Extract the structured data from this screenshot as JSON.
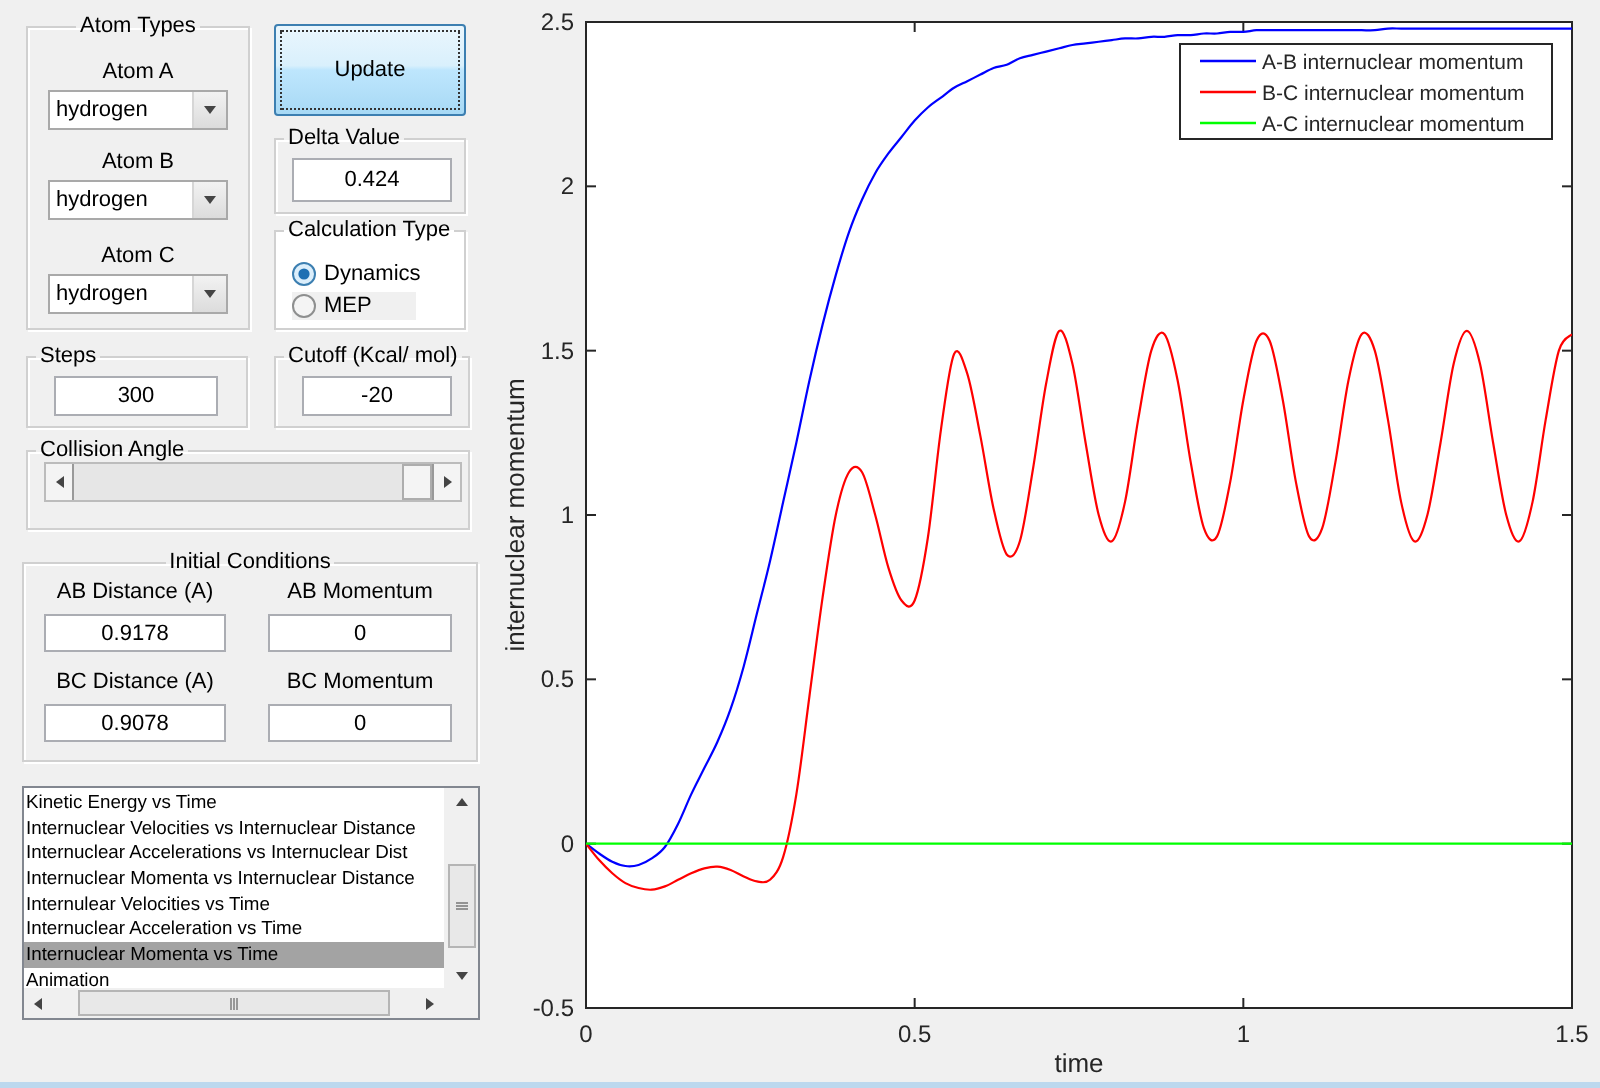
{
  "atom_types": {
    "title": "Atom Types",
    "atoms": [
      {
        "label": "Atom A",
        "value": "hydrogen"
      },
      {
        "label": "Atom B",
        "value": "hydrogen"
      },
      {
        "label": "Atom C",
        "value": "hydrogen"
      }
    ]
  },
  "update_button": "Update",
  "delta_value": {
    "title": "Delta Value",
    "value": "0.424"
  },
  "calculation_type": {
    "title": "Calculation Type",
    "options": [
      {
        "label": "Dynamics",
        "selected": true
      },
      {
        "label": "MEP",
        "selected": false
      }
    ]
  },
  "steps": {
    "title": "Steps",
    "value": "300"
  },
  "cutoff": {
    "title": "Cutoff (Kcal/ mol)",
    "value": "-20"
  },
  "collision_angle": {
    "title": "Collision Angle",
    "level": 1
  },
  "initial_conditions": {
    "title": "Initial Conditions",
    "fields": [
      {
        "label": "AB Distance (A)",
        "value": "0.9178"
      },
      {
        "label": "AB Momentum",
        "value": "0"
      },
      {
        "label": "BC Distance (A)",
        "value": "0.9078"
      },
      {
        "label": "BC Momentum",
        "value": "0"
      }
    ]
  },
  "plot_list": {
    "items": [
      {
        "label": "Kinetic Energy vs Time",
        "selected": false
      },
      {
        "label": "Internuclear Velocities vs Internuclear Distance",
        "selected": false
      },
      {
        "label": "Internuclear Accelerations vs Internuclear Dist",
        "selected": false
      },
      {
        "label": "Internuclear Momenta vs Internuclear Distance",
        "selected": false
      },
      {
        "label": "Internulear Velocities vs Time",
        "selected": false
      },
      {
        "label": "Internuclear Acceleration vs Time",
        "selected": false
      },
      {
        "label": "Internuclear Momenta vs Time",
        "selected": true
      },
      {
        "label": "Animation",
        "selected": false
      }
    ]
  },
  "plot": {
    "chart_data": {
      "type": "line",
      "legend": true,
      "xlabel": "time",
      "ylabel": "internuclear momentum",
      "xlim": [
        0,
        1.5
      ],
      "ylim": [
        -0.5,
        2.5
      ],
      "xticks": [
        {
          "value": 0,
          "label": "0"
        },
        {
          "value": 0.5,
          "label": "0.5"
        },
        {
          "value": 1,
          "label": "1"
        },
        {
          "value": 1.5,
          "label": "1.5"
        }
      ],
      "yticks": [
        {
          "value": -0.5,
          "label": "-0.5"
        },
        {
          "value": 0,
          "label": "0"
        },
        {
          "value": 0.5,
          "label": "0.5"
        },
        {
          "value": 1,
          "label": "1"
        },
        {
          "value": 1.5,
          "label": "1.5"
        },
        {
          "value": 2,
          "label": "2"
        },
        {
          "value": 2.5,
          "label": "2.5"
        }
      ],
      "x": [
        0,
        0.02,
        0.04,
        0.06,
        0.08,
        0.1,
        0.12,
        0.14,
        0.16,
        0.18,
        0.2,
        0.22,
        0.24,
        0.26,
        0.28,
        0.3,
        0.32,
        0.34,
        0.36,
        0.38,
        0.4,
        0.42,
        0.44,
        0.46,
        0.48,
        0.5,
        0.52,
        0.54,
        0.56,
        0.58,
        0.6,
        0.62,
        0.64,
        0.66,
        0.68,
        0.7,
        0.72,
        0.74,
        0.76,
        0.78,
        0.8,
        0.82,
        0.84,
        0.86,
        0.88,
        0.9,
        0.92,
        0.94,
        0.96,
        0.98,
        1,
        1.02,
        1.04,
        1.06,
        1.08,
        1.1,
        1.12,
        1.14,
        1.16,
        1.18,
        1.2,
        1.22,
        1.24,
        1.26,
        1.28,
        1.3,
        1.32,
        1.34,
        1.36,
        1.38,
        1.4,
        1.42,
        1.44,
        1.46,
        1.48,
        1.5
      ],
      "series": [
        {
          "name": "A-B internuclear momentum",
          "color": "#0000ff",
          "values": [
            0,
            -0.03,
            -0.055,
            -0.068,
            -0.065,
            -0.045,
            -0.01,
            0.06,
            0.15,
            0.23,
            0.31,
            0.41,
            0.54,
            0.7,
            0.86,
            1.04,
            1.22,
            1.41,
            1.58,
            1.73,
            1.86,
            1.96,
            2.04,
            2.1,
            2.15,
            2.2,
            2.24,
            2.27,
            2.3,
            2.32,
            2.34,
            2.36,
            2.37,
            2.39,
            2.4,
            2.41,
            2.42,
            2.43,
            2.435,
            2.44,
            2.445,
            2.45,
            2.45,
            2.455,
            2.455,
            2.46,
            2.46,
            2.465,
            2.465,
            2.47,
            2.47,
            2.475,
            2.475,
            2.475,
            2.475,
            2.475,
            2.475,
            2.475,
            2.475,
            2.475,
            2.475,
            2.48,
            2.48,
            2.48,
            2.48,
            2.48,
            2.48,
            2.48,
            2.48,
            2.48,
            2.48,
            2.48,
            2.48,
            2.48,
            2.48,
            2.48
          ]
        },
        {
          "name": "B-C internuclear momentum",
          "color": "#ff0000",
          "values": [
            0,
            -0.05,
            -0.09,
            -0.12,
            -0.135,
            -0.14,
            -0.13,
            -0.11,
            -0.09,
            -0.075,
            -0.07,
            -0.08,
            -0.1,
            -0.115,
            -0.11,
            -0.04,
            0.15,
            0.45,
            0.75,
            1,
            1.13,
            1.13,
            1,
            0.84,
            0.74,
            0.74,
            0.93,
            1.26,
            1.49,
            1.43,
            1.24,
            1.02,
            0.88,
            0.92,
            1.14,
            1.4,
            1.56,
            1.46,
            1.22,
            1,
            0.92,
            1.04,
            1.29,
            1.5,
            1.55,
            1.41,
            1.16,
            0.96,
            0.935,
            1.1,
            1.35,
            1.53,
            1.53,
            1.35,
            1.1,
            0.935,
            0.96,
            1.16,
            1.41,
            1.55,
            1.5,
            1.29,
            1.04,
            0.92,
            1,
            1.22,
            1.46,
            1.56,
            1.46,
            1.22,
            1,
            0.92,
            1.04,
            1.29,
            1.5,
            1.55
          ]
        },
        {
          "name": "A-C internuclear momentum",
          "color": "#00ff00",
          "values": [
            0,
            0,
            0,
            0,
            0,
            0,
            0,
            0,
            0,
            0,
            0,
            0,
            0,
            0,
            0,
            0,
            0,
            0,
            0,
            0,
            0,
            0,
            0,
            0,
            0,
            0,
            0,
            0,
            0,
            0,
            0,
            0,
            0,
            0,
            0,
            0,
            0,
            0,
            0,
            0,
            0,
            0,
            0,
            0,
            0,
            0,
            0,
            0,
            0,
            0,
            0,
            0,
            0,
            0,
            0,
            0,
            0,
            0,
            0,
            0,
            0,
            0,
            0,
            0,
            0,
            0,
            0,
            0,
            0,
            0,
            0,
            0,
            0,
            0,
            0,
            0
          ]
        }
      ]
    }
  }
}
